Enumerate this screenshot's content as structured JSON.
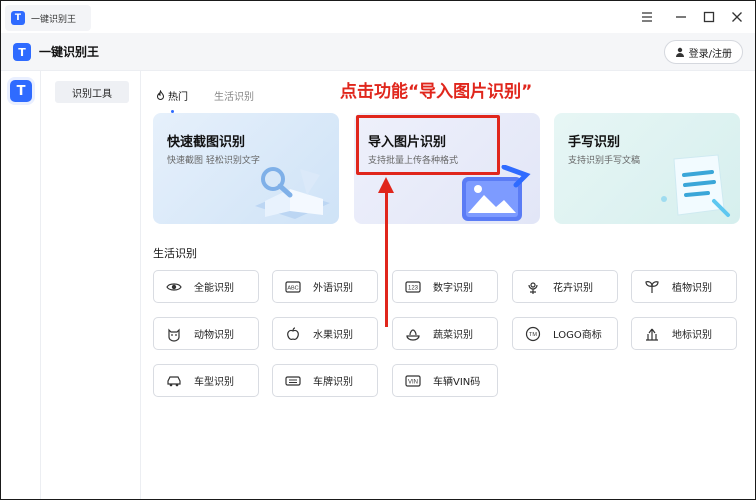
{
  "window": {
    "tab_title": "一键识别王",
    "logo_letter": "T"
  },
  "app": {
    "title": "一键识别王",
    "login_label": "登录/注册"
  },
  "sidebar": {
    "items": [
      {
        "label": "识别工具"
      }
    ]
  },
  "tabs": [
    {
      "label": "热门"
    },
    {
      "label": "生活识别"
    }
  ],
  "annotation": "点击功能“导入图片识别”",
  "cards": [
    {
      "title": "快速截图识别",
      "subtitle": "快速截图 轻松识别文字"
    },
    {
      "title": "导入图片识别",
      "subtitle": "支持批量上传各种格式"
    },
    {
      "title": "手写识别",
      "subtitle": "支持识别手写文稿"
    }
  ],
  "section": {
    "title": "生活识别"
  },
  "features": [
    {
      "label": "全能识别",
      "icon": "eye-icon"
    },
    {
      "label": "外语识别",
      "icon": "abc-icon"
    },
    {
      "label": "数字识别",
      "icon": "123-icon"
    },
    {
      "label": "花卉识别",
      "icon": "flower-icon"
    },
    {
      "label": "植物识别",
      "icon": "leaf-icon"
    },
    {
      "label": "动物识别",
      "icon": "cat-icon"
    },
    {
      "label": "水果识别",
      "icon": "apple-icon"
    },
    {
      "label": "蔬菜识别",
      "icon": "veg-icon"
    },
    {
      "label": "LOGO商标",
      "icon": "tm-icon"
    },
    {
      "label": "地标识别",
      "icon": "landmark-icon"
    },
    {
      "label": "车型识别",
      "icon": "car-icon"
    },
    {
      "label": "车牌识别",
      "icon": "plate-icon"
    },
    {
      "label": "车辆VIN码",
      "icon": "vin-icon"
    }
  ],
  "colors": {
    "accent": "#2f6bff",
    "annotation": "#e0261c"
  }
}
